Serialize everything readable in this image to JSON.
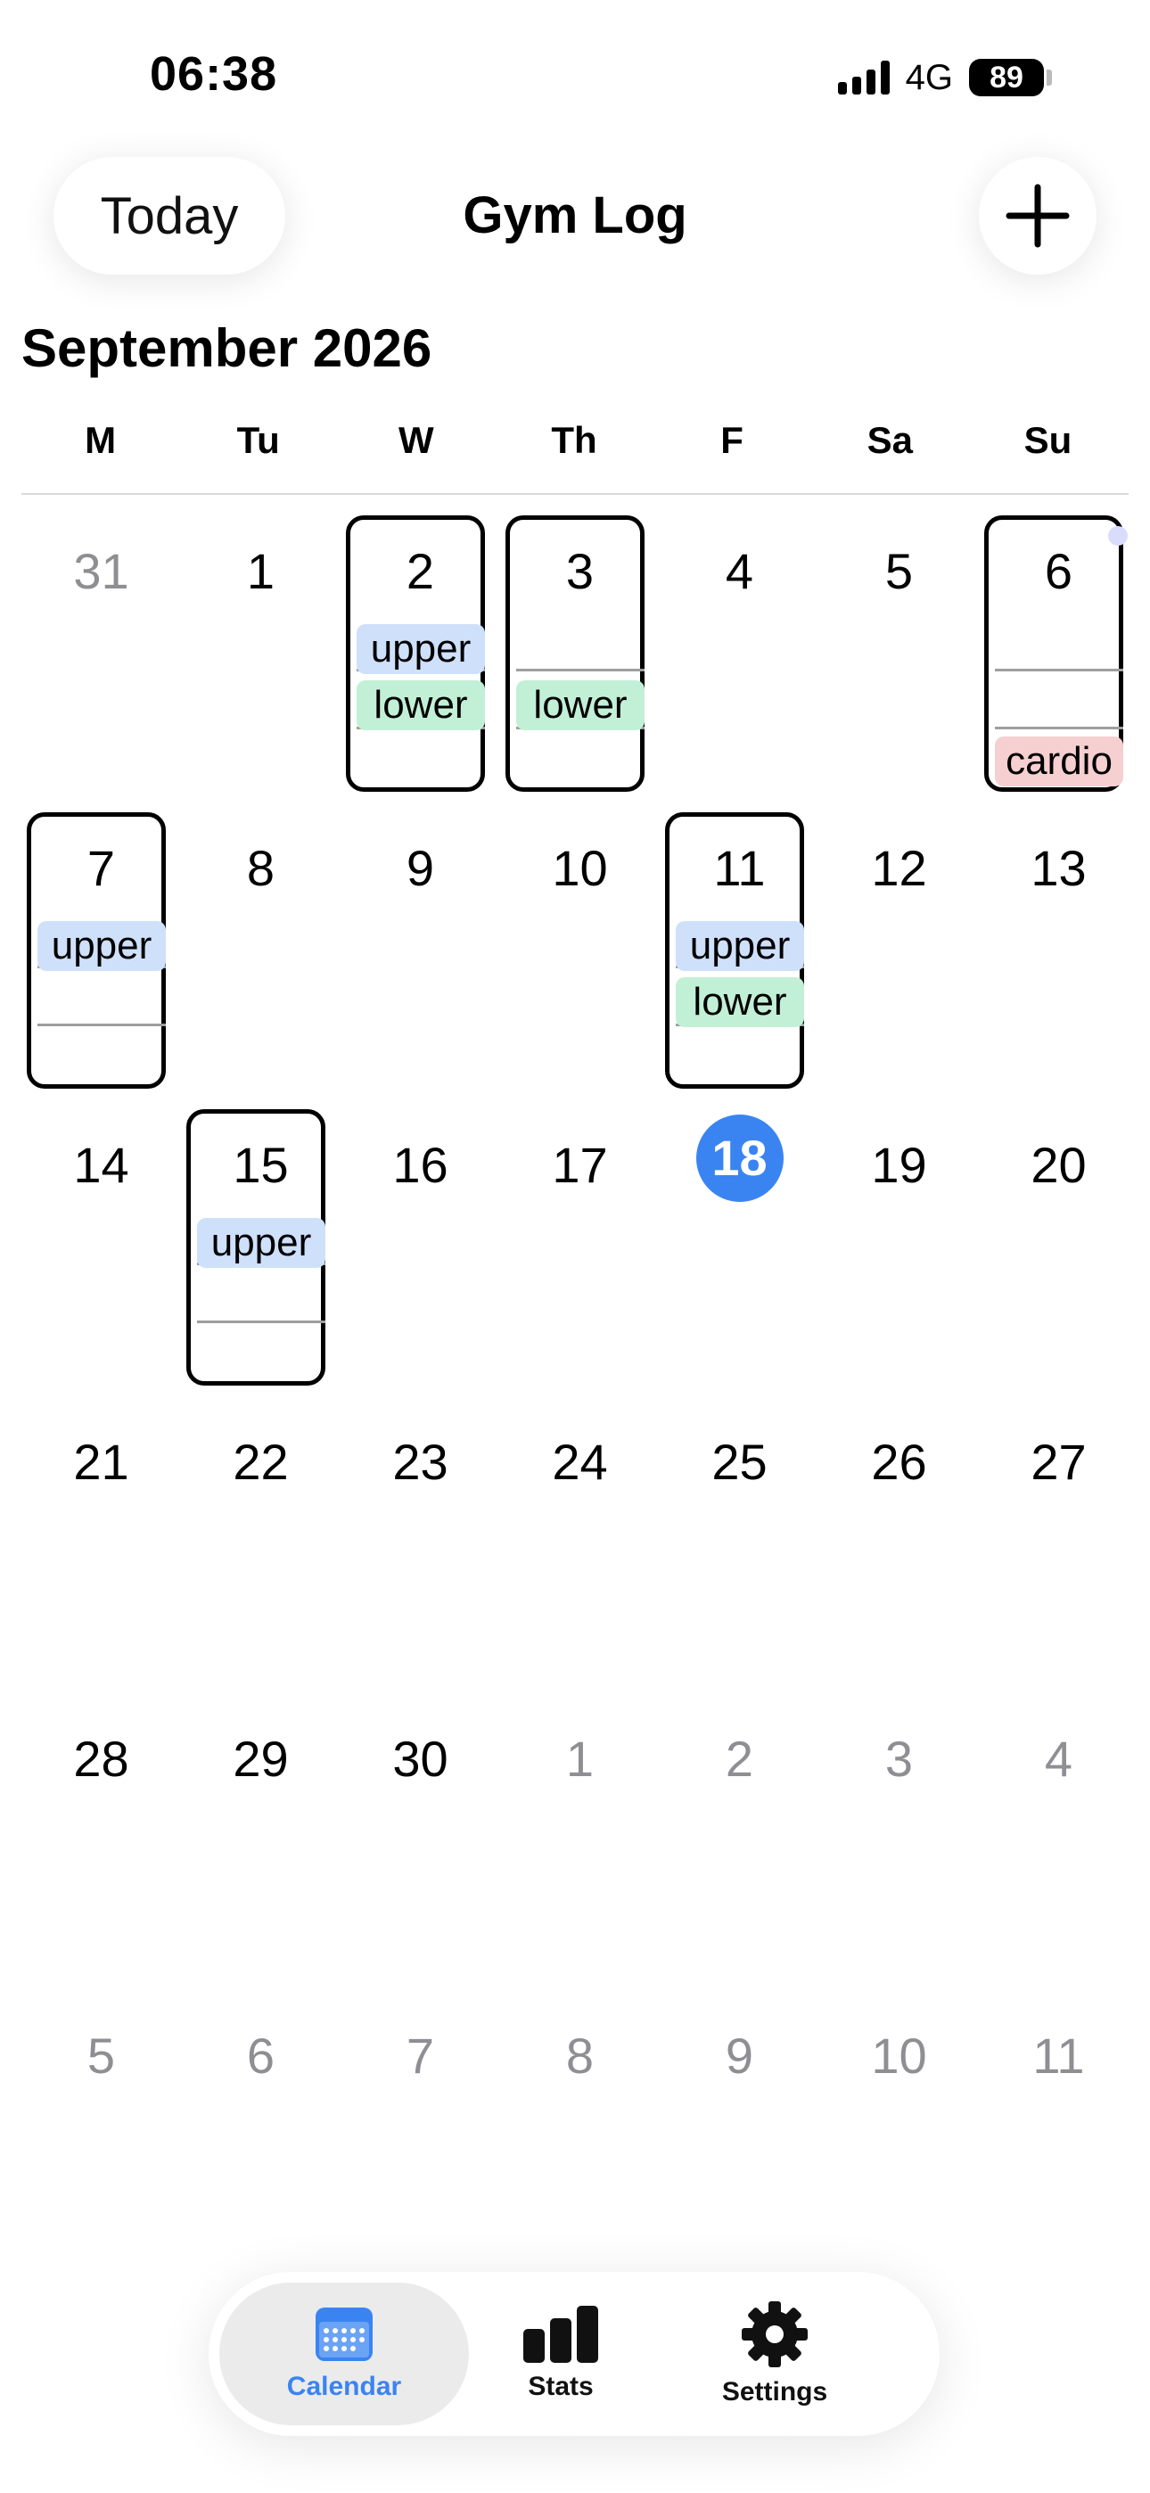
{
  "status_bar": {
    "time": "06:38",
    "network": "4G",
    "battery": "89"
  },
  "header": {
    "today_label": "Today",
    "title": "Gym Log"
  },
  "month_title": "September 2026",
  "weekdays": [
    "M",
    "Tu",
    "W",
    "Th",
    "F",
    "Sa",
    "Su"
  ],
  "weeks": [
    [
      {
        "n": "31",
        "muted": true
      },
      {
        "n": "1"
      },
      {
        "n": "2",
        "logged": true,
        "upper": "upper",
        "lower": "lower"
      },
      {
        "n": "3",
        "logged": true,
        "lower": "lower"
      },
      {
        "n": "4"
      },
      {
        "n": "5"
      },
      {
        "n": "6",
        "logged": true,
        "cardio": "cardio",
        "dot": true
      }
    ],
    [
      {
        "n": "7",
        "logged": true,
        "upper": "upper"
      },
      {
        "n": "8"
      },
      {
        "n": "9"
      },
      {
        "n": "10"
      },
      {
        "n": "11",
        "logged": true,
        "upper": "upper",
        "lower": "lower"
      },
      {
        "n": "12"
      },
      {
        "n": "13"
      }
    ],
    [
      {
        "n": "14"
      },
      {
        "n": "15",
        "logged": true,
        "upper": "upper"
      },
      {
        "n": "16"
      },
      {
        "n": "17"
      },
      {
        "n": "18",
        "today": true
      },
      {
        "n": "19"
      },
      {
        "n": "20"
      }
    ],
    [
      {
        "n": "21"
      },
      {
        "n": "22"
      },
      {
        "n": "23"
      },
      {
        "n": "24"
      },
      {
        "n": "25"
      },
      {
        "n": "26"
      },
      {
        "n": "27"
      }
    ],
    [
      {
        "n": "28"
      },
      {
        "n": "29"
      },
      {
        "n": "30"
      },
      {
        "n": "1",
        "muted": true
      },
      {
        "n": "2",
        "muted": true
      },
      {
        "n": "3",
        "muted": true
      },
      {
        "n": "4",
        "muted": true
      }
    ],
    [
      {
        "n": "5",
        "muted": true
      },
      {
        "n": "6",
        "muted": true
      },
      {
        "n": "7",
        "muted": true
      },
      {
        "n": "8",
        "muted": true
      },
      {
        "n": "9",
        "muted": true
      },
      {
        "n": "10",
        "muted": true
      },
      {
        "n": "11",
        "muted": true
      }
    ]
  ],
  "tabs": [
    {
      "label": "Calendar",
      "icon": "calendar-icon",
      "selected": true
    },
    {
      "label": "Stats",
      "icon": "bar-chart-icon"
    },
    {
      "label": "Settings",
      "icon": "gear-icon"
    }
  ],
  "colors": {
    "accent": "#3a84f2",
    "upper": "#cfe0fb",
    "lower": "#c2f0d6",
    "cardio": "#f6cfd1"
  }
}
